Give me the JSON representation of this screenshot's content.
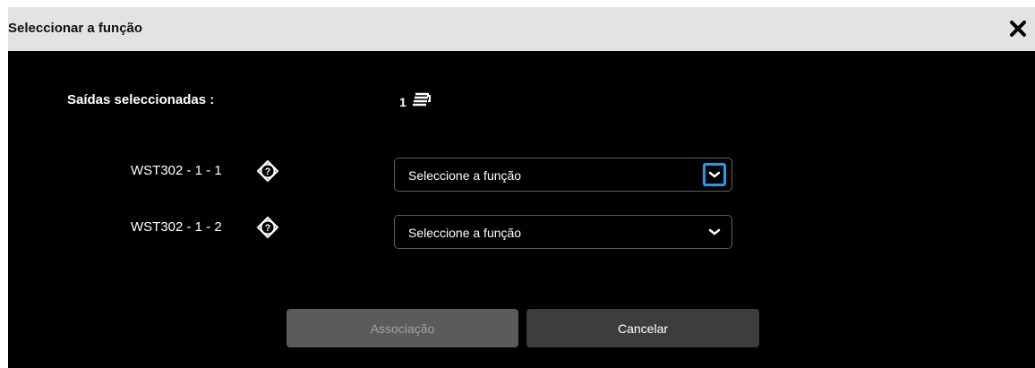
{
  "dialog": {
    "title": "Seleccionar a função",
    "close_icon": "close-icon"
  },
  "selected_outputs": {
    "label": "Saídas seleccionadas :",
    "count": "1",
    "icon": "stack-icon"
  },
  "outputs": [
    {
      "name": "WST302 - 1 - 1",
      "help_icon": "help-icon",
      "select_value": "Seleccione a função",
      "dropdown_focused": true
    },
    {
      "name": "WST302 - 1 - 2",
      "help_icon": "help-icon",
      "select_value": "Seleccione a função",
      "dropdown_focused": false
    }
  ],
  "buttons": {
    "associate": "Associação",
    "cancel": "Cancelar"
  },
  "colors": {
    "background": "#000000",
    "titlebar": "#e3e3e3",
    "focus": "#1aa0e6",
    "button_disabled": "#5b5b5b",
    "button_cancel": "#3d3d3d"
  }
}
